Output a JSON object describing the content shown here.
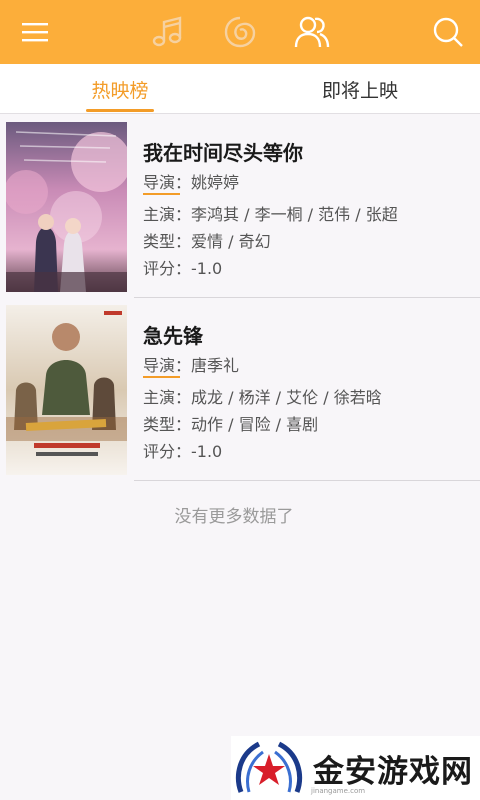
{
  "colors": {
    "accent": "#fcae3a",
    "tab_active": "#f39c28"
  },
  "appbar": {
    "icons": [
      "menu-icon",
      "music-icon",
      "swirl-icon",
      "people-icon",
      "search-icon"
    ]
  },
  "tabs": [
    {
      "label": "热映榜",
      "active": true
    },
    {
      "label": "即将上映",
      "active": false
    }
  ],
  "movies": [
    {
      "title": "我在时间尽头等你",
      "director": "导演：姚婷婷",
      "cast": "主演：李鸿其 / 李一桐 / 范伟 / 张超",
      "genre": "类型：爱情 / 奇幻",
      "rating": "评分：-1.0"
    },
    {
      "title": "急先锋",
      "director": "导演：唐季礼",
      "cast": "主演：成龙 / 杨洋 / 艾伦 / 徐若晗",
      "genre": "类型：动作 / 冒险 / 喜剧",
      "rating": "评分：-1.0"
    }
  ],
  "footer": {
    "text": "没有更多数据了"
  },
  "watermark": {
    "text": "金安游戏网",
    "sub": "jinangame.com"
  }
}
